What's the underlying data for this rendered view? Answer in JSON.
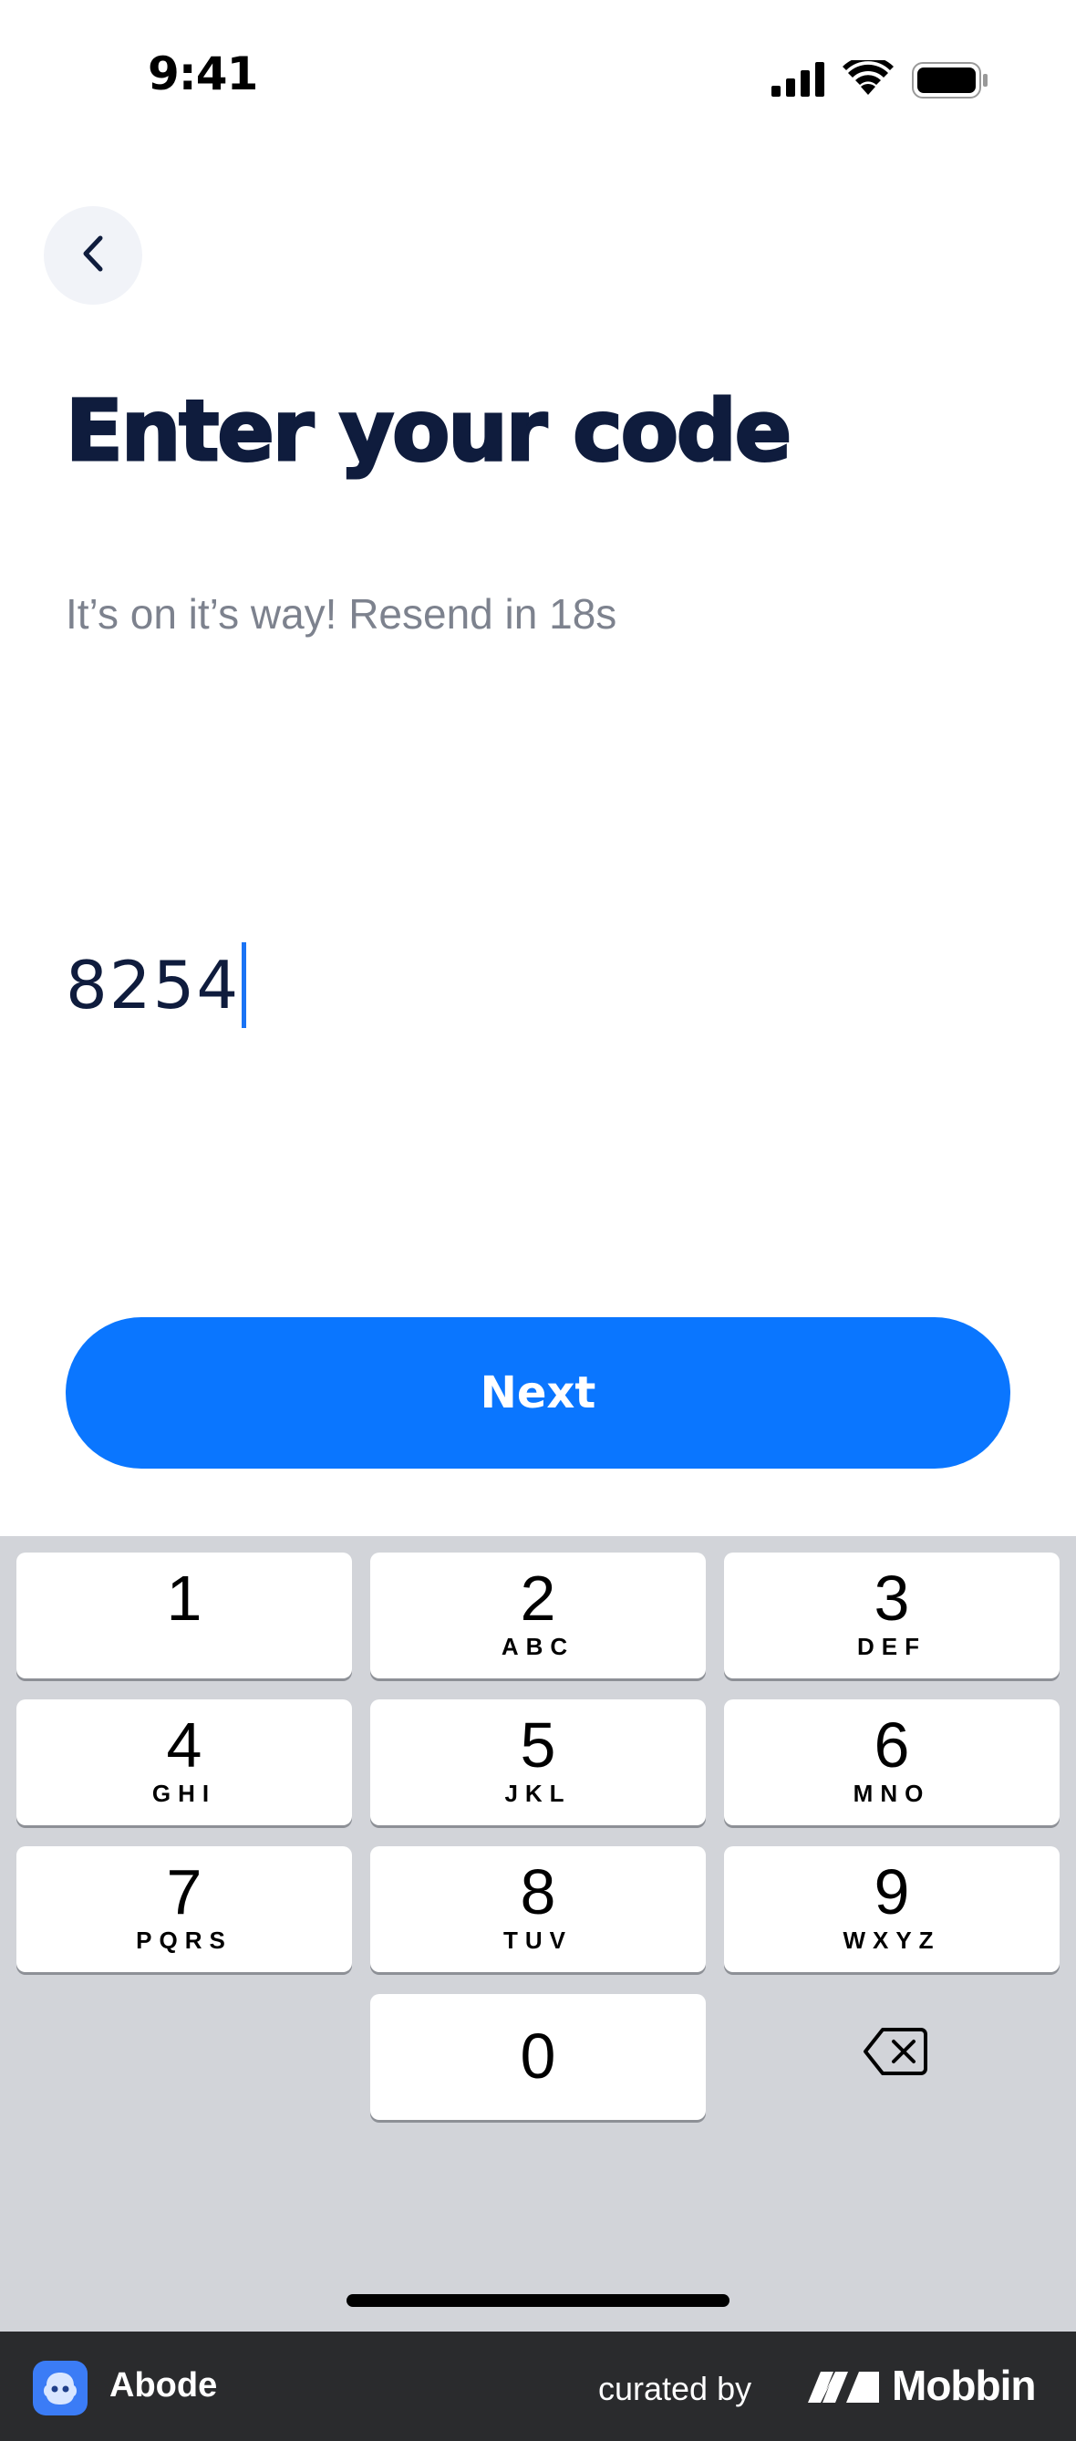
{
  "status_bar": {
    "time": "9:41",
    "signal_icon": "cellular-signal-icon",
    "wifi_icon": "wifi-icon",
    "battery_icon": "battery-icon"
  },
  "nav": {
    "back_icon": "chevron-left-icon"
  },
  "header": {
    "title": "Enter your code",
    "subtitle": "It’s on it’s way! Resend in 18s"
  },
  "code_field": {
    "value": "8254"
  },
  "next_button": {
    "label": "Next"
  },
  "keypad": {
    "keys": [
      {
        "digit": "1",
        "letters": ""
      },
      {
        "digit": "2",
        "letters": "ABC"
      },
      {
        "digit": "3",
        "letters": "DEF"
      },
      {
        "digit": "4",
        "letters": "GHI"
      },
      {
        "digit": "5",
        "letters": "JKL"
      },
      {
        "digit": "6",
        "letters": "MNO"
      },
      {
        "digit": "7",
        "letters": "PQRS"
      },
      {
        "digit": "8",
        "letters": "TUV"
      },
      {
        "digit": "9",
        "letters": "WXYZ"
      },
      {
        "digit": "0",
        "letters": ""
      }
    ],
    "delete_icon": "backspace-icon"
  },
  "footer": {
    "app_name": "Abode",
    "curated_by": "curated by",
    "brand": "Mobbin"
  },
  "colors": {
    "primary": "#0a76ff",
    "title": "#0f1c3d",
    "subtitle": "#7d828e",
    "keyboard_bg": "#d2d4d9",
    "footer_bg": "#2a2b2d"
  }
}
